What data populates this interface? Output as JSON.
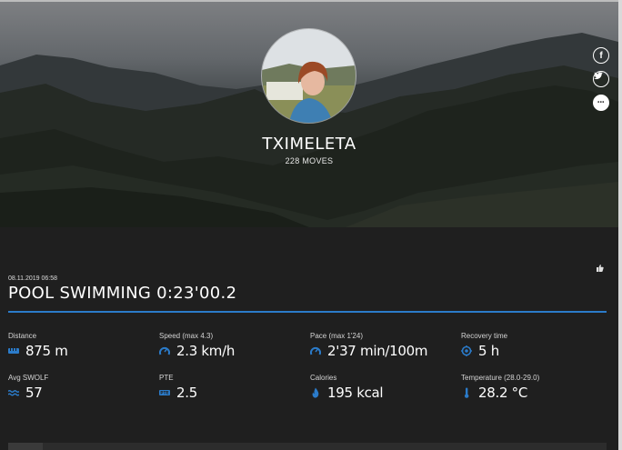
{
  "profile": {
    "username": "TXIMELETA",
    "moves": "228 MOVES"
  },
  "share": {
    "facebook_icon": "f",
    "twitter_icon": "twitter-bird",
    "more_icon": "•••"
  },
  "move": {
    "date": "08.11.2019 06:58",
    "title": "POOL SWIMMING  0:23'00.2"
  },
  "stats": {
    "distance": {
      "label": "Distance",
      "value": "875 m",
      "icon": "distance-icon"
    },
    "speed": {
      "label": "Speed  (max   4.3)",
      "value": "2.3 km/h",
      "icon": "speedometer-icon"
    },
    "pace": {
      "label": "Pace  (max   1'24)",
      "value": "2'37 min/100m",
      "icon": "speedometer-icon"
    },
    "recovery": {
      "label": "Recovery time",
      "value": "5 h",
      "icon": "target-icon"
    },
    "swolf": {
      "label": "Avg SWOLF",
      "value": "57",
      "icon": "waves-icon"
    },
    "pte": {
      "label": "PTE",
      "value": "2.5",
      "icon": "pte-icon"
    },
    "calories": {
      "label": "Calories",
      "value": "195 kcal",
      "icon": "flame-icon"
    },
    "temperature": {
      "label": "Temperature  (28.0-29.0)",
      "value": "28.2 °C",
      "icon": "thermometer-icon"
    }
  },
  "colors": {
    "accent": "#2b7bc9",
    "background": "#1f1f1f"
  }
}
